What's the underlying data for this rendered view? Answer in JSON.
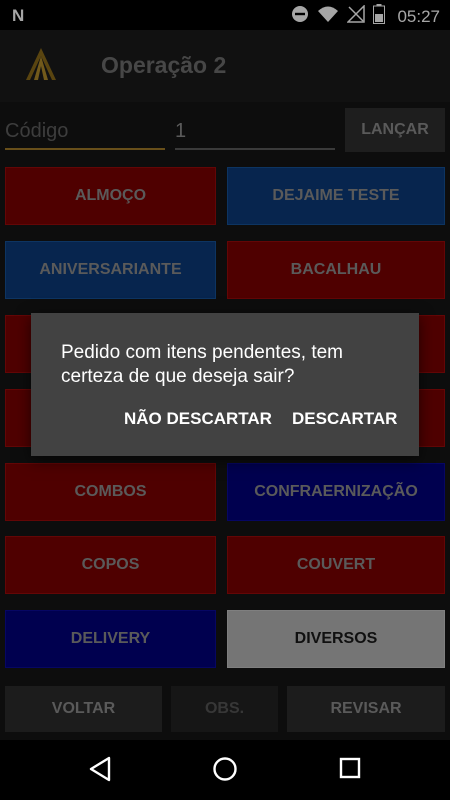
{
  "status_bar": {
    "notification_icon": "n-app-icon",
    "time": "05:27"
  },
  "app_bar": {
    "title": "Operação 2"
  },
  "entry": {
    "code_placeholder": "Código",
    "quantity_value": "1",
    "launch_label": "LANÇAR"
  },
  "categories": [
    {
      "label": "ALMOÇO",
      "color": "#7a0000"
    },
    {
      "label": "DEJAIME TESTE",
      "color": "#0b3a78"
    },
    {
      "label": "ANIVERSARIANTE",
      "color": "#0b3a78"
    },
    {
      "label": "BACALHAU",
      "color": "#7a0000"
    },
    {
      "label": "COMBOS",
      "color": "#7a0000"
    },
    {
      "label": "CONFRAERNIZAÇÃO",
      "color": "#00007a"
    },
    {
      "label": "COPOS",
      "color": "#7a0000"
    },
    {
      "label": "COUVERT",
      "color": "#7a0000"
    },
    {
      "label": "DELIVERY",
      "color": "#00007a"
    },
    {
      "label": "DIVERSOS",
      "color": "#b4b4b4"
    }
  ],
  "bottom_bar": {
    "back_label": "VOLTAR",
    "obs_label": "OBS.",
    "review_label": "REVISAR"
  },
  "dialog": {
    "message": "Pedido com itens pendentes, tem certeza de que deseja sair?",
    "cancel_label": "NÃO DESCARTAR",
    "confirm_label": "DESCARTAR"
  }
}
